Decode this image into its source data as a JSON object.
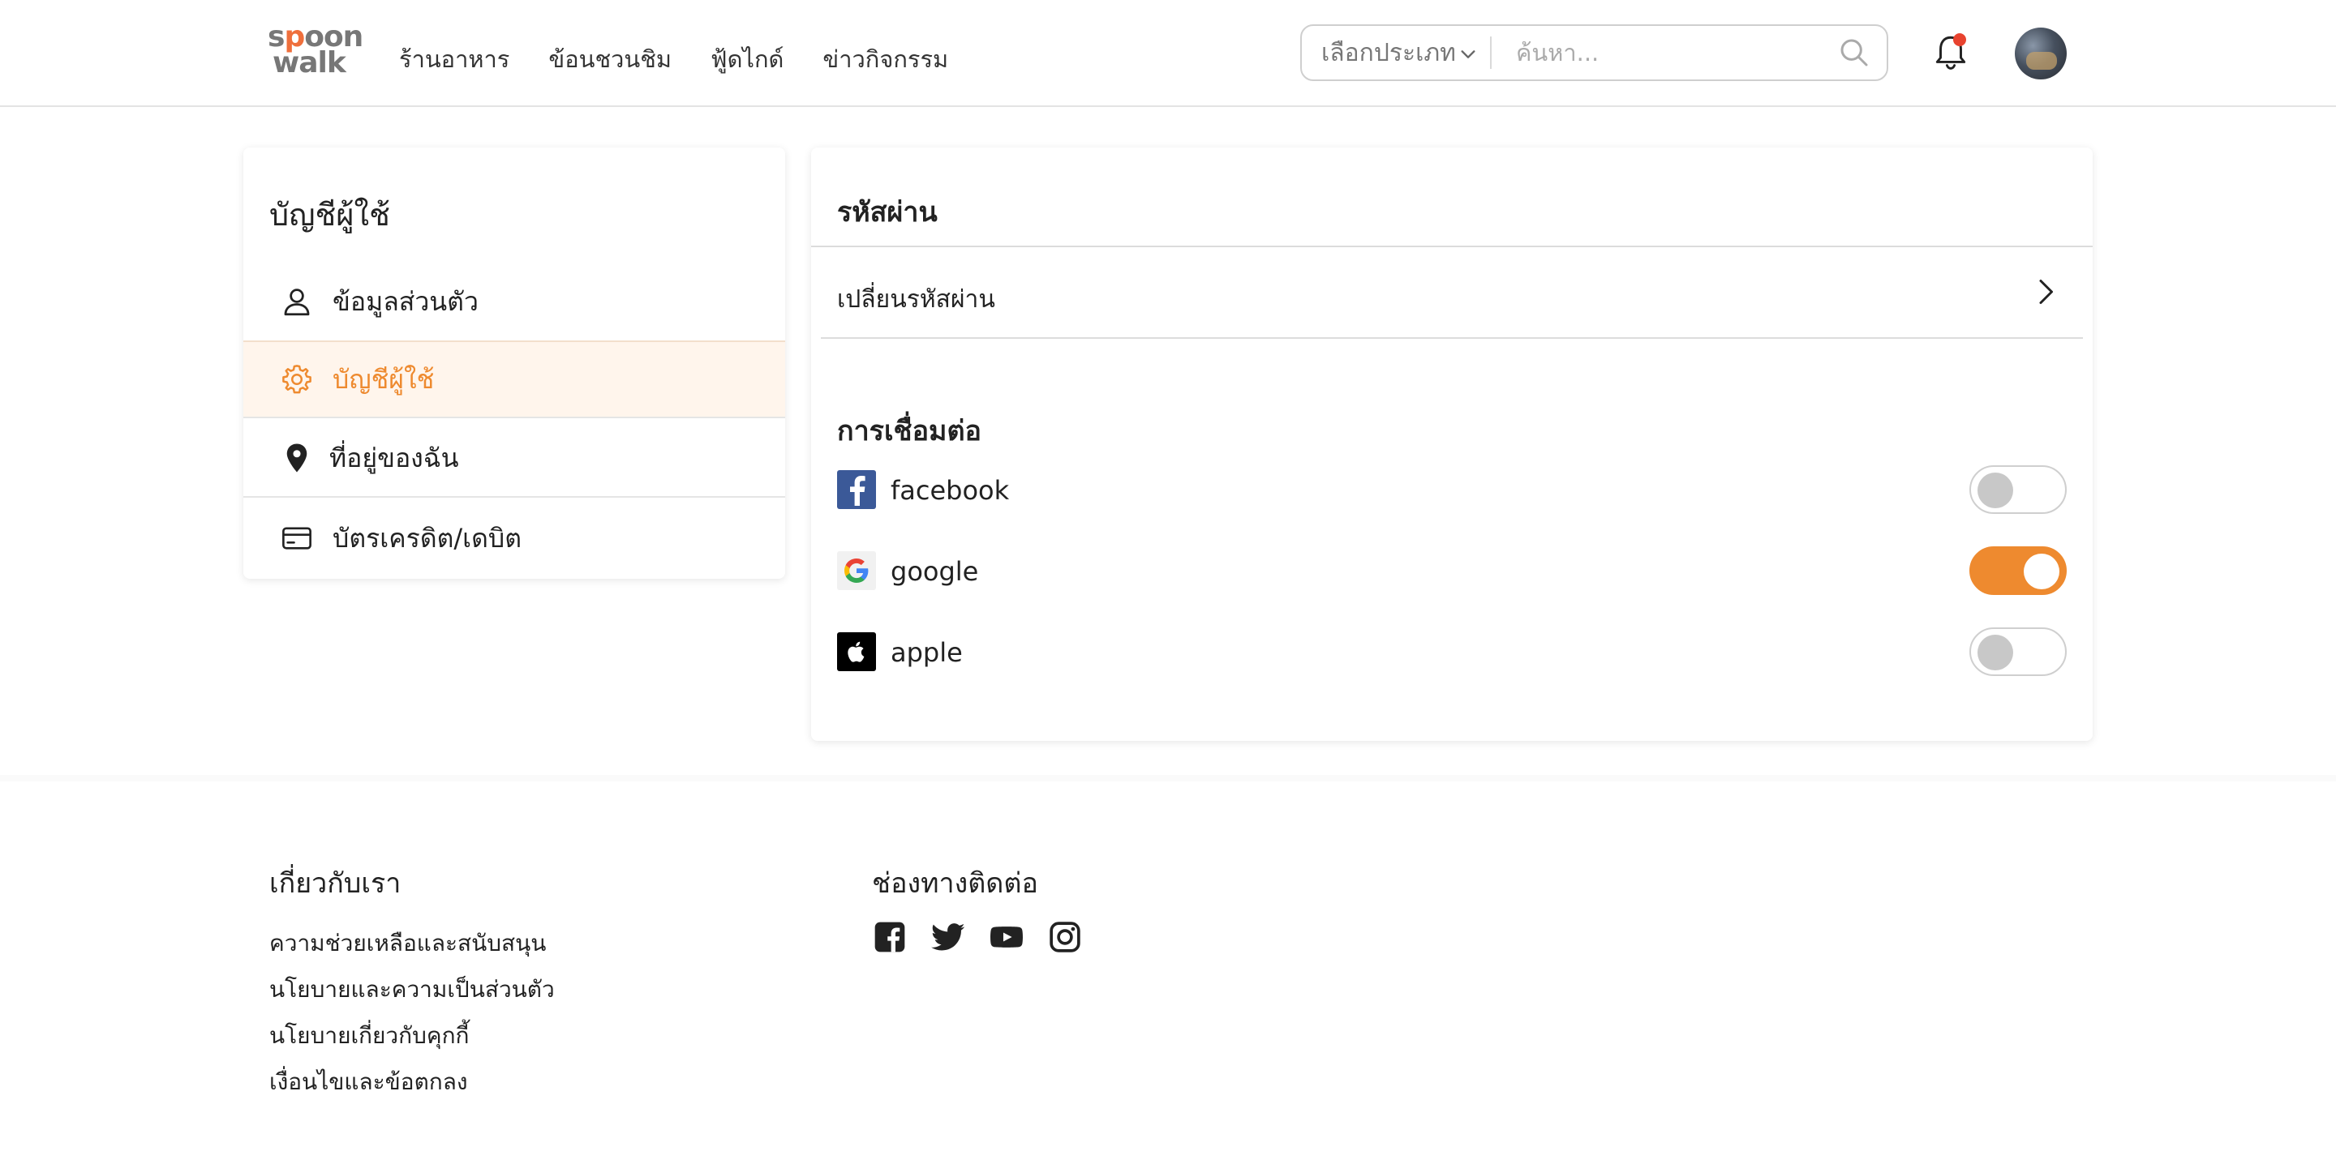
{
  "header": {
    "logo": {
      "line1": "spoon",
      "line2": "walk"
    },
    "nav": [
      "ร้านอาหาร",
      "ข้อนชวนชิม",
      "ฟู้ดไกด์",
      "ข่าวกิจกรรม"
    ],
    "search": {
      "category": "เลือกประเภท",
      "placeholder": "ค้นหา..."
    }
  },
  "sidebar": {
    "title": "บัญชีผู้ใช้",
    "items": [
      {
        "label": "ข้อมูลส่วนตัว",
        "icon": "user-icon"
      },
      {
        "label": "บัญชีผู้ใช้",
        "icon": "gear-icon",
        "active": true
      },
      {
        "label": "ที่อยู่ของฉัน",
        "icon": "location-pin-icon"
      },
      {
        "label": "บัตรเครดิต/เดบิต",
        "icon": "credit-card-icon"
      }
    ]
  },
  "main": {
    "password_title": "รหัสผ่าน",
    "change_password": "เปลี่ยนรหัสผ่าน",
    "connections_title": "การเชื่อมต่อ",
    "connections": [
      {
        "name": "facebook",
        "enabled": false
      },
      {
        "name": "google",
        "enabled": true
      },
      {
        "name": "apple",
        "enabled": false
      }
    ]
  },
  "footer": {
    "about_title": "เกี่ยวกับเรา",
    "about_links": [
      "ความช่วยเหลือและสนับสนุน",
      "นโยบายและความเป็นส่วนตัว",
      "นโยบายเกี่ยวกับคุกกี้",
      "เงื่อนไขและข้อตกลง"
    ],
    "contact_title": "ช่องทางติดต่อ",
    "social": [
      "facebook-icon",
      "twitter-icon",
      "youtube-icon",
      "instagram-icon"
    ]
  },
  "colors": {
    "accent": "#ee8a2f",
    "logo_accent": "#ef6f3c",
    "active_bg": "#fff5ec",
    "notification": "#e8432f"
  }
}
